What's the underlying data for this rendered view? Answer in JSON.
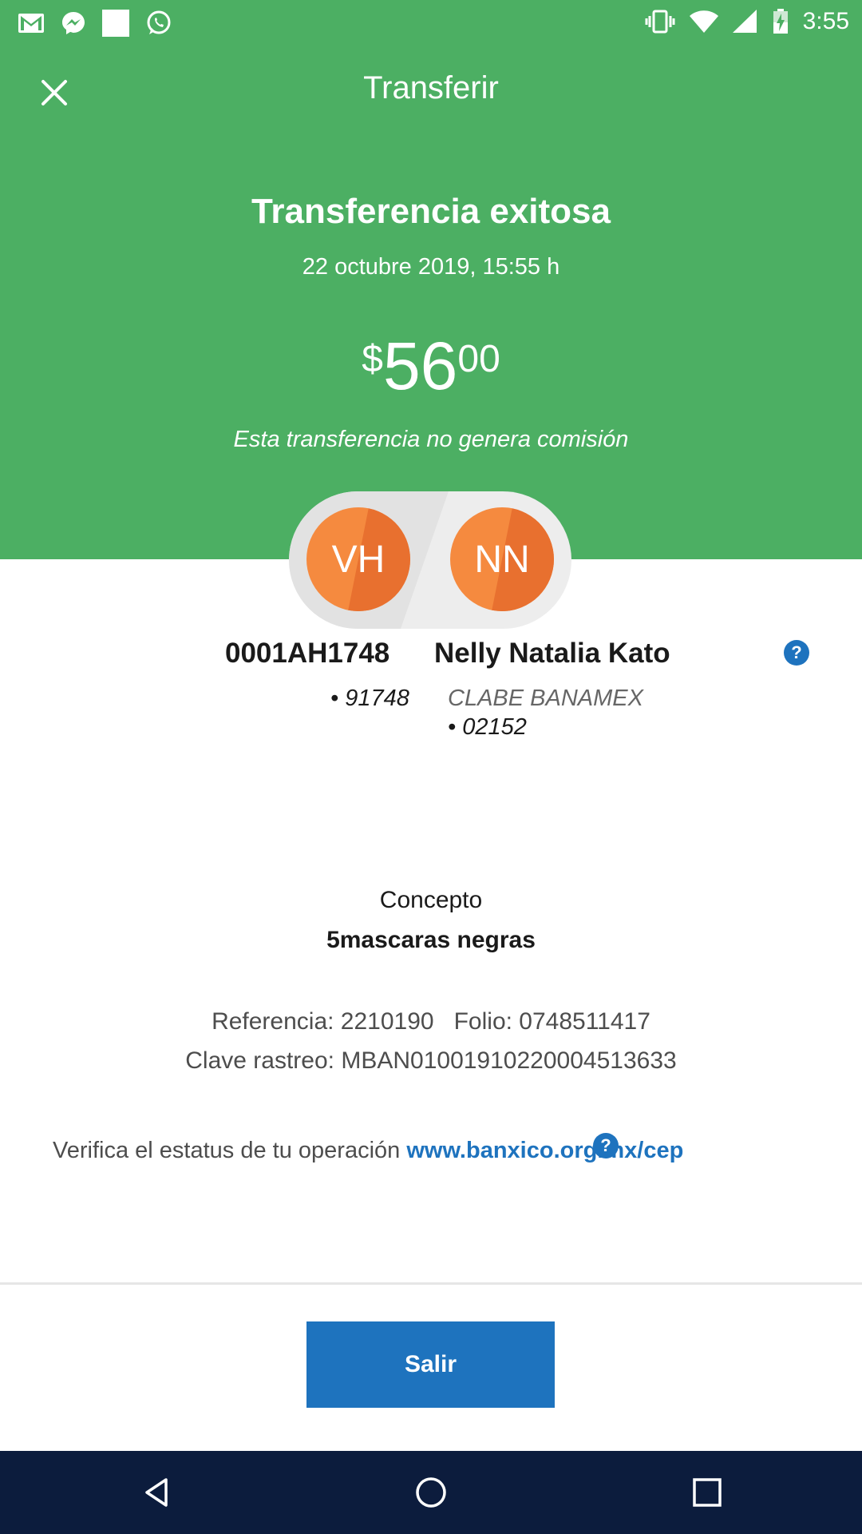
{
  "status_bar": {
    "time": "3:55",
    "left_icons": [
      "gmail-icon",
      "messenger-icon",
      "square-notification-icon",
      "whatsapp-icon"
    ],
    "right_icons": [
      "vibrate-icon",
      "wifi-icon",
      "signal-icon",
      "battery-charging-icon"
    ]
  },
  "app_bar": {
    "title": "Transferir",
    "close_icon": "close-icon"
  },
  "summary": {
    "title": "Transferencia exitosa",
    "datetime": "22 octubre 2019, 15:55 h",
    "amount": {
      "currency": "$",
      "integer": "56",
      "decimal": "00"
    },
    "commission_note": "Esta transferencia no genera comisión"
  },
  "accounts": {
    "from": {
      "initials": "VH",
      "name": "0001AH1748",
      "detail": "• 91748"
    },
    "to": {
      "initials": "NN",
      "name": "Nelly Natalia Kato",
      "bank": "CLABE BANAMEX",
      "detail": "• 02152"
    }
  },
  "details": {
    "concept_label": "Concepto",
    "concept_value": "5mascaras negras",
    "reference_line": "Referencia: 2210190   Folio: 0748511417",
    "tracking_line": "Clave rastreo: MBAN01001910220004513633",
    "verify_text": "Verifica el estatus de tu operación ",
    "verify_link": "www.banxico.org.mx/cep"
  },
  "help_icon_glyph": "?",
  "actions": {
    "exit_label": "Salir"
  },
  "colors": {
    "header_green": "#4caf63",
    "primary_blue": "#1e73be",
    "avatar_orange": "#f58a3f",
    "nav_bar": "#0c1c3d"
  }
}
